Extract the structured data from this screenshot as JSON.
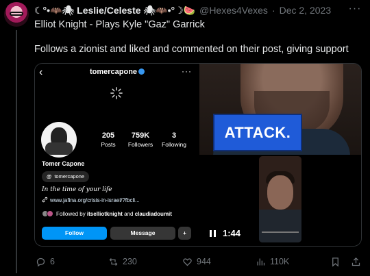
{
  "tweet": {
    "display_name": "☾°•🦇🕷 Leslie/Celeste 🕷🦇•°☽🍉",
    "handle": "@Hexes4Vexes",
    "separator": "·",
    "date": "Dec 2, 2023",
    "more_label": "···",
    "text_line1": "Elliot Knight - Plays Kyle \"Gaz\" Garrick",
    "text_line2": "Follows a zionist and liked and commented on their post, giving support"
  },
  "instagram": {
    "back": "‹",
    "username": "tomercapone",
    "more": "···",
    "stats": [
      {
        "value": "205",
        "label": "Posts"
      },
      {
        "value": "759K",
        "label": "Followers"
      },
      {
        "value": "3",
        "label": "Following"
      }
    ],
    "name": "Tomer Capone",
    "threads_icon": "@",
    "threads_handle": "tomercapone",
    "bio": "In the time of your life",
    "link": "www.jafina.org/crisis-in-israel/?fbcli...",
    "followed_prefix": "Followed by ",
    "followed_names": "itselliotknight",
    "followed_and": " and ",
    "followed_names2": "claudiadoumit",
    "follow_button": "Follow",
    "message_button": "Message",
    "add_icon": "+"
  },
  "video": {
    "overlay_text": "ATTACK.",
    "time": "1:44"
  },
  "actions": {
    "replies": "6",
    "retweets": "230",
    "likes": "944",
    "views": "110K"
  },
  "colors": {
    "background": "#000000",
    "muted": "#71767b",
    "ig_blue": "#0095f6",
    "attack_blue": "#1f5bd8"
  }
}
